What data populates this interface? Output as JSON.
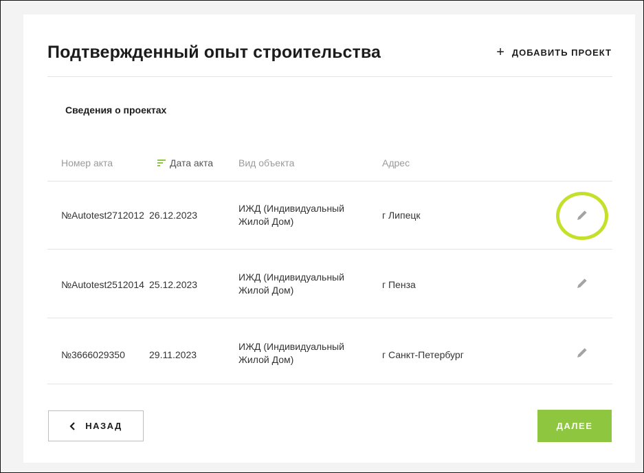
{
  "header": {
    "title": "Подтвержденный опыт строительства",
    "add_label": "ДОБАВИТЬ ПРОЕКТ"
  },
  "section": {
    "title": "Сведения о проектах"
  },
  "table": {
    "columns": [
      "Номер акта",
      "Дата акта",
      "Вид объекта",
      "Адрес"
    ],
    "sorted_column": "Дата акта",
    "rows": [
      {
        "number": "№Autotest2712012",
        "date": "26.12.2023",
        "object_line1": "ИЖД (Индивидуальный",
        "object_line2": "Жилой Дом)",
        "address": "г Липецк"
      },
      {
        "number": "№Autotest2512014",
        "date": "25.12.2023",
        "object_line1": "ИЖД (Индивидуальный",
        "object_line2": "Жилой Дом)",
        "address": "г Пенза"
      },
      {
        "number": "№3666029350",
        "date": "29.11.2023",
        "object_line1": "ИЖД (Индивидуальный",
        "object_line2": "Жилой Дом)",
        "address": "г Санкт-Петербург"
      }
    ]
  },
  "footer": {
    "back_label": "НАЗАД",
    "next_label": "ДАЛЕЕ"
  },
  "icons": {
    "add": "plus-icon",
    "sort": "sort-icon",
    "edit": "pencil-icon",
    "back": "chevron-left-icon"
  },
  "colors": {
    "accent": "#8ec63f",
    "highlight": "#c5e02a",
    "muted_text": "#9a9a9a",
    "divider": "#e3e3e3"
  }
}
